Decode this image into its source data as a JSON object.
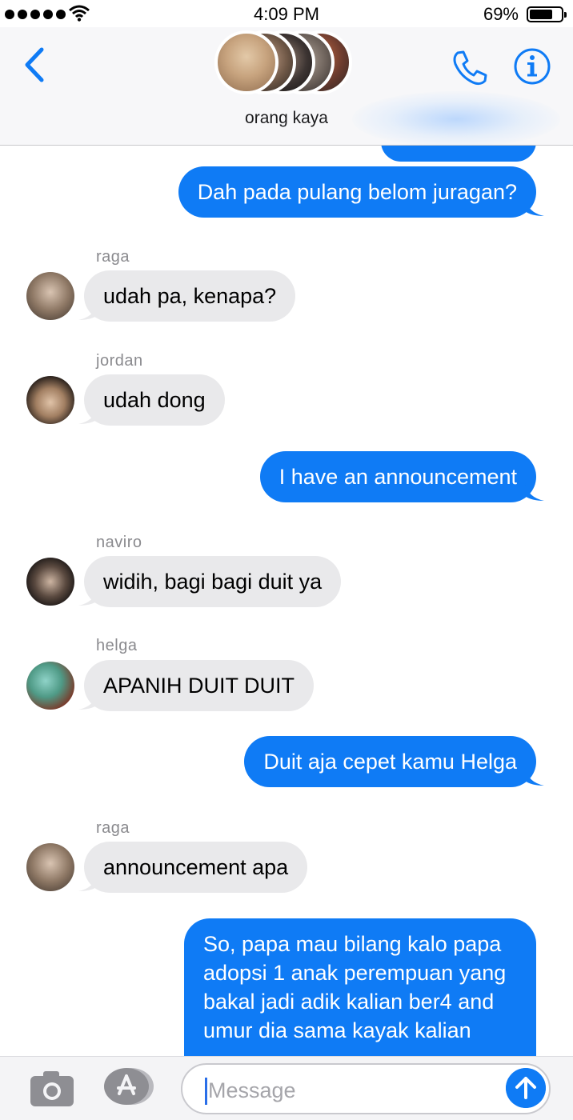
{
  "status_bar": {
    "time": "4:09 PM",
    "battery_percent": "69%",
    "signal_icon": "signal-dots-icon",
    "wifi_icon": "wifi-icon",
    "battery_icon": "battery-icon",
    "battery_level": 0.69
  },
  "header": {
    "group_name": "orang kaya",
    "back_icon": "chevron-left-icon",
    "call_icon": "phone-icon",
    "info_icon": "info-icon",
    "accent_color": "#0f7bf5"
  },
  "messages": [
    {
      "direction": "out",
      "text": "Dah pada pulang belom juragan?"
    },
    {
      "direction": "in",
      "sender": "raga",
      "text": "udah pa, kenapa?"
    },
    {
      "direction": "in",
      "sender": "jordan",
      "text": "udah dong"
    },
    {
      "direction": "out",
      "text": "I have an announcement"
    },
    {
      "direction": "in",
      "sender": "naviro",
      "text": "widih, bagi bagi duit ya"
    },
    {
      "direction": "in",
      "sender": "helga",
      "text": "APANIH DUIT DUIT"
    },
    {
      "direction": "out",
      "text": "Duit aja cepet kamu Helga"
    },
    {
      "direction": "in",
      "sender": "raga",
      "text": "announcement apa"
    },
    {
      "direction": "out",
      "lines": [
        "So, papa mau bilang kalo papa",
        "adopsi 1 anak perempuan yang",
        "bakal jadi adik kalian ber4 and",
        "umur dia sama kayak kalian"
      ]
    }
  ],
  "composer": {
    "placeholder": "Message",
    "camera_icon": "camera-icon",
    "apps_icon": "app-store-icon",
    "send_icon": "arrow-up-icon"
  },
  "colors": {
    "outgoing_bubble": "#0f7bf5",
    "incoming_bubble": "#e9e9eb",
    "sender_label": "#8a8a8e"
  }
}
